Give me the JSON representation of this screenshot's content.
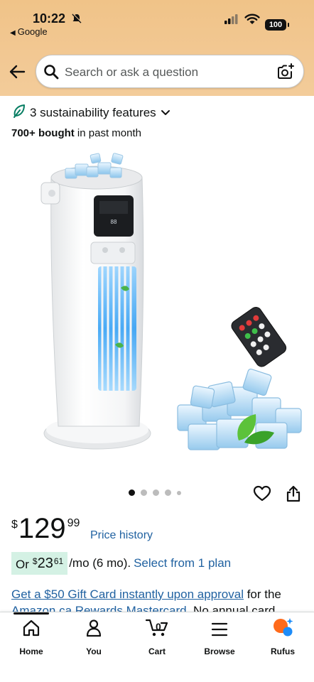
{
  "status_bar": {
    "time": "10:22",
    "back_app": "Google",
    "battery": "100"
  },
  "search": {
    "placeholder": "Search or ask a question"
  },
  "product": {
    "sustainability": "3 sustainability features",
    "bought_bold": "700+ bought",
    "bought_rest": " in past month",
    "carousel": {
      "count": 5,
      "active_index": 0
    }
  },
  "price": {
    "currency": "$",
    "whole": "129",
    "fraction": "99",
    "history_link": "Price history"
  },
  "installment": {
    "prefix": "Or",
    "currency": "$",
    "whole": "23",
    "fraction": "61",
    "term": "/mo (6 mo).",
    "link": "Select from 1 plan"
  },
  "promo": {
    "link": "Get a $50 Gift Card instantly upon approval",
    "rest": " for the",
    "line2_link": "Amazon.ca Rewards Mastercard",
    "line2_rest": ". No annual card"
  },
  "bottom_nav": {
    "items": [
      {
        "label": "Home",
        "icon": "home-icon"
      },
      {
        "label": "You",
        "icon": "person-icon"
      },
      {
        "label": "Cart",
        "icon": "cart-icon",
        "count": "0"
      },
      {
        "label": "Browse",
        "icon": "menu-icon"
      },
      {
        "label": "Rufus",
        "icon": "rufus-icon"
      }
    ]
  },
  "colors": {
    "header_bg": "#f2c893",
    "link": "#2162a1",
    "installment_chip": "#d4f1e4",
    "rufus_orange": "#ff6a1a",
    "rufus_blue": "#1d8cf8",
    "sustain_green": "#067d62"
  }
}
